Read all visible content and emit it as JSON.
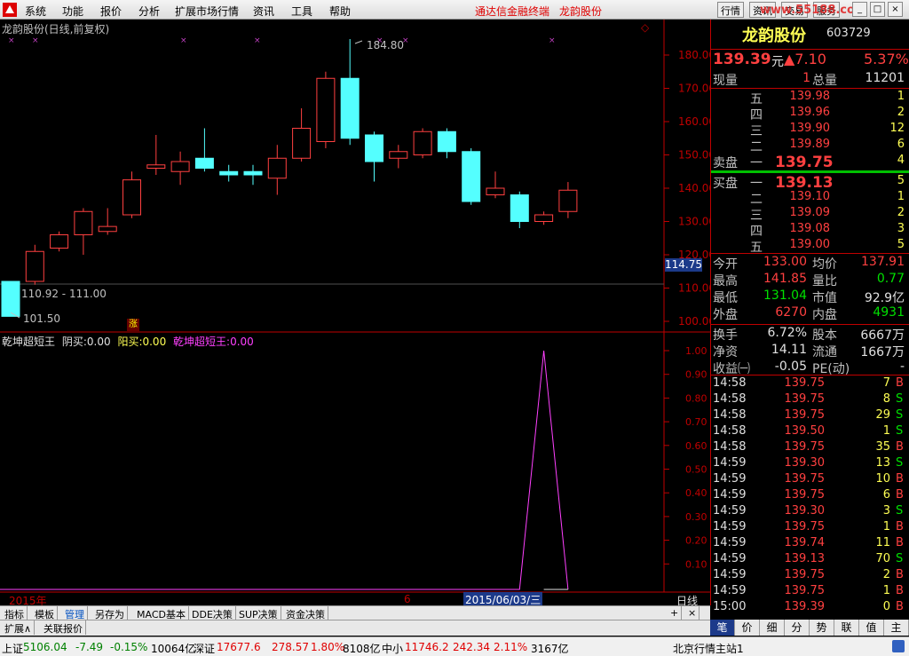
{
  "menu": {
    "items": [
      "系统",
      "功能",
      "报价",
      "分析",
      "扩展市场行情",
      "资讯",
      "工具",
      "帮助"
    ],
    "red_items": [
      "通达信金融终端",
      "龙韵股份"
    ],
    "buttons": [
      "行情",
      "资讯",
      "交易",
      "服务"
    ],
    "watermark": "www.55188.com"
  },
  "chart": {
    "title": "龙韵股份(日线,前复权)",
    "marker": "◇",
    "price_ticks": [
      "180.00",
      "170.00",
      "160.00",
      "150.00",
      "140.00",
      "130.00",
      "120.00",
      "110.00",
      "100.00"
    ],
    "current_price_tag": "114.75",
    "high_label": "184.80",
    "low_label": "101.50",
    "range_label": "110.92 - 111.00",
    "zhang_label": "涨",
    "year_label": "2015年",
    "month_label": "6",
    "date_label": "2015/06/03/三",
    "period_label": "日线"
  },
  "indicator": {
    "name": "乾坤超短王",
    "yin_label": "阴买:",
    "yin_value": "0.00",
    "yang_label": "阳买:",
    "yang_value": "0.00",
    "line_label": "乾坤超短王:",
    "line_value": "0.00",
    "ticks": [
      "1.00",
      "0.90",
      "0.80",
      "0.70",
      "0.60",
      "0.50",
      "0.40",
      "0.30",
      "0.20",
      "0.10"
    ]
  },
  "chart_data": {
    "type": "candlestick",
    "title": "龙韵股份(日线,前复权)",
    "ylim": [
      100,
      185
    ],
    "candles": [
      {
        "o": 112,
        "c": 101.5,
        "h": 112,
        "l": 101.5
      },
      {
        "o": 112,
        "c": 121,
        "h": 123,
        "l": 111
      },
      {
        "o": 122,
        "c": 126,
        "h": 127,
        "l": 121
      },
      {
        "o": 126,
        "c": 133,
        "h": 134,
        "l": 120
      },
      {
        "o": 127,
        "c": 128.5,
        "h": 134,
        "l": 126
      },
      {
        "o": 132,
        "c": 142.5,
        "h": 145,
        "l": 131
      },
      {
        "o": 146,
        "c": 147,
        "h": 156,
        "l": 144
      },
      {
        "o": 145,
        "c": 148,
        "h": 151,
        "l": 141
      },
      {
        "o": 149,
        "c": 146,
        "h": 158,
        "l": 145
      },
      {
        "o": 145,
        "c": 144,
        "h": 147,
        "l": 142
      },
      {
        "o": 145,
        "c": 144,
        "h": 147,
        "l": 141
      },
      {
        "o": 143,
        "c": 149,
        "h": 153,
        "l": 138
      },
      {
        "o": 149,
        "c": 158,
        "h": 164,
        "l": 148
      },
      {
        "o": 154,
        "c": 173,
        "h": 175,
        "l": 152
      },
      {
        "o": 173,
        "c": 155,
        "h": 184.8,
        "l": 153
      },
      {
        "o": 156,
        "c": 148,
        "h": 157,
        "l": 142
      },
      {
        "o": 149,
        "c": 151,
        "h": 153,
        "l": 146
      },
      {
        "o": 150,
        "c": 157,
        "h": 158,
        "l": 149
      },
      {
        "o": 157,
        "c": 151,
        "h": 158,
        "l": 149
      },
      {
        "o": 151,
        "c": 136,
        "h": 152,
        "l": 135
      },
      {
        "o": 138,
        "c": 140,
        "h": 145,
        "l": 137
      },
      {
        "o": 138,
        "c": 130,
        "h": 139,
        "l": 128
      },
      {
        "o": 130,
        "c": 132,
        "h": 133,
        "l": 129
      },
      {
        "o": 133,
        "c": 139.4,
        "h": 141.85,
        "l": 131
      }
    ],
    "indicator_values": [
      0,
      0,
      0,
      0,
      0,
      0,
      0,
      0,
      0,
      0,
      0,
      0,
      0,
      0,
      0,
      0,
      0,
      0,
      0,
      0,
      0,
      0,
      1,
      0
    ]
  },
  "quote": {
    "name": "龙韵股份",
    "code": "603729",
    "price": "139.39",
    "unit": "元",
    "arrow_change": "▲7.10",
    "pct": "5.37%",
    "now_label": "现量",
    "now_value": "1",
    "total_label": "总量",
    "total_value": "11201",
    "sells": [
      {
        "lvl": "五",
        "price": "139.98",
        "vol": "1"
      },
      {
        "lvl": "四",
        "price": "139.96",
        "vol": "2"
      },
      {
        "lvl": "三",
        "price": "139.90",
        "vol": "12"
      },
      {
        "lvl": "二",
        "price": "139.89",
        "vol": "6"
      },
      {
        "lvl": "一",
        "price": "139.75",
        "vol": "4"
      }
    ],
    "buys": [
      {
        "lvl": "一",
        "price": "139.13",
        "vol": "5"
      },
      {
        "lvl": "二",
        "price": "139.10",
        "vol": "1"
      },
      {
        "lvl": "三",
        "price": "139.09",
        "vol": "2"
      },
      {
        "lvl": "四",
        "price": "139.08",
        "vol": "3"
      },
      {
        "lvl": "五",
        "price": "139.00",
        "vol": "5"
      }
    ],
    "sell_label": "卖盘",
    "buy_label": "买盘",
    "stats": [
      [
        "今开",
        "133.00",
        "均价",
        "137.91"
      ],
      [
        "最高",
        "141.85",
        "量比",
        "0.77"
      ],
      [
        "最低",
        "131.04",
        "市值",
        "92.9亿"
      ],
      [
        "外盘",
        "6270",
        "内盘",
        "4931"
      ]
    ],
    "stats2": [
      [
        "换手",
        "6.72%",
        "股本",
        "6667万"
      ],
      [
        "净资",
        "14.11",
        "流通",
        "1667万"
      ],
      [
        "收益㈠",
        "-0.05",
        "PE(动)",
        "-"
      ]
    ]
  },
  "ticks": [
    [
      "14:58",
      "139.75",
      "7",
      "B"
    ],
    [
      "14:58",
      "139.75",
      "8",
      "S"
    ],
    [
      "14:58",
      "139.75",
      "29",
      "S"
    ],
    [
      "14:58",
      "139.50",
      "1",
      "S"
    ],
    [
      "14:58",
      "139.75",
      "35",
      "B"
    ],
    [
      "14:59",
      "139.30",
      "13",
      "S"
    ],
    [
      "14:59",
      "139.75",
      "10",
      "B"
    ],
    [
      "14:59",
      "139.75",
      "6",
      "B"
    ],
    [
      "14:59",
      "139.30",
      "3",
      "S"
    ],
    [
      "14:59",
      "139.75",
      "1",
      "B"
    ],
    [
      "14:59",
      "139.74",
      "11",
      "B"
    ],
    [
      "14:59",
      "139.13",
      "70",
      "S"
    ],
    [
      "14:59",
      "139.75",
      "2",
      "B"
    ],
    [
      "14:59",
      "139.75",
      "1",
      "B"
    ],
    [
      "15:00",
      "139.39",
      "0",
      "B"
    ]
  ],
  "subtabs": [
    "指标",
    "模板",
    "管理",
    "另存为",
    "MACD基本",
    "DDE决策",
    "SUP决策",
    "资金决策"
  ],
  "extbar": [
    "扩展∧",
    "关联报价"
  ],
  "sidetabs": [
    "笔",
    "价",
    "细",
    "分",
    "势",
    "联",
    "值",
    "主"
  ],
  "status": {
    "sh_label": "上证",
    "sh_val": "5106.04",
    "sh_chg": "-7.49",
    "sh_pct": "-0.15%",
    "sh_amt": "10064亿",
    "sz_label": "深证",
    "sz_val": "17677.6",
    "sz_chg": "278.57",
    "sz_pct": "1.80%",
    "sz_amt": "8108亿",
    "zx_label": "中小",
    "zx_val": "11746.2",
    "zx_chg": "242.34",
    "zx_pct": "2.11%",
    "zx_amt": "3167亿",
    "server": "北京行情主站1"
  }
}
